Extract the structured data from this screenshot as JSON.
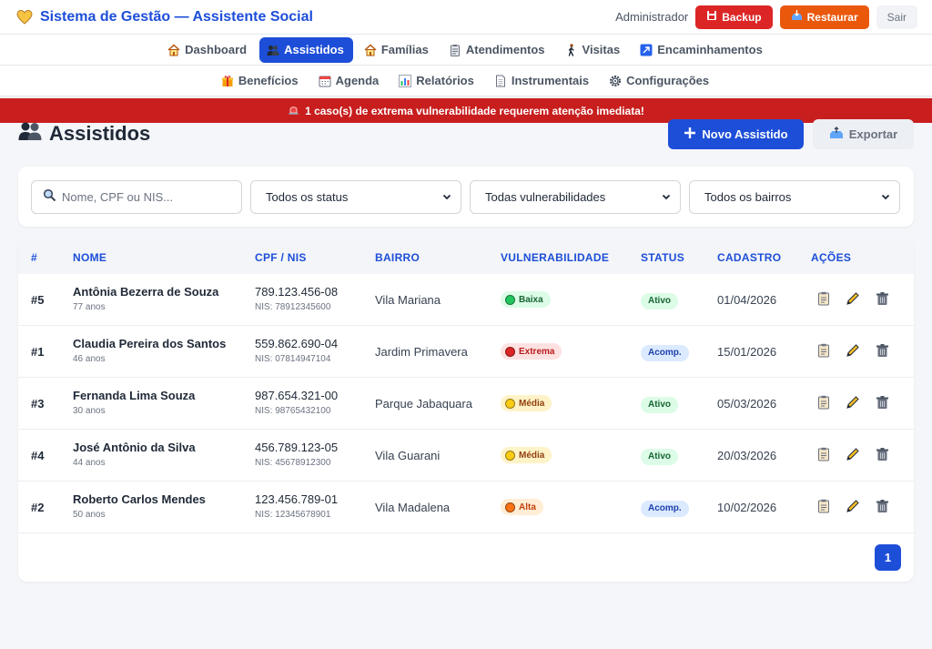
{
  "app": {
    "title": "Sistema de Gestão — Assistente Social",
    "user": "Administrador",
    "backup_label": "Backup",
    "restore_label": "Restaurar",
    "logout_label": "Sair"
  },
  "nav": {
    "primary": [
      {
        "label": "Dashboard",
        "icon": "house-icon",
        "active": false
      },
      {
        "label": "Assistidos",
        "icon": "people-icon",
        "active": true
      },
      {
        "label": "Famílias",
        "icon": "house-icon",
        "active": false
      },
      {
        "label": "Atendimentos",
        "icon": "clipboard-icon",
        "active": false
      },
      {
        "label": "Visitas",
        "icon": "walking-icon",
        "active": false
      },
      {
        "label": "Encaminhamentos",
        "icon": "arrow-up-right-icon",
        "active": false
      }
    ],
    "secondary": [
      {
        "label": "Benefícios",
        "icon": "gift-icon"
      },
      {
        "label": "Agenda",
        "icon": "calendar-icon"
      },
      {
        "label": "Relatórios",
        "icon": "bar-chart-icon"
      },
      {
        "label": "Instrumentais",
        "icon": "document-icon"
      },
      {
        "label": "Configurações",
        "icon": "gear-icon"
      }
    ]
  },
  "alert": {
    "text": "1 caso(s) de extrema vulnerabilidade requerem atenção imediata!",
    "icon": "siren-icon"
  },
  "page": {
    "title": "Assistidos",
    "new_label": "Novo Assistido",
    "export_label": "Exportar"
  },
  "filters": {
    "search_placeholder": "Nome, CPF ou NIS...",
    "status_value": "Todos os status",
    "vulnerability_value": "Todas vulnerabilidades",
    "neighborhood_value": "Todos os bairros"
  },
  "table": {
    "headers": [
      "#",
      "NOME",
      "CPF / NIS",
      "BAIRRO",
      "VULNERABILIDADE",
      "STATUS",
      "CADASTRO",
      "AÇÕES"
    ],
    "rows": [
      {
        "id": "#5",
        "name": "Antônia Bezerra de Souza",
        "age": "77 anos",
        "cpf": "789.123.456-08",
        "nis": "NIS: 78912345600",
        "bairro": "Vila Mariana",
        "vul": "Baixa",
        "vul_color": "#22c55e",
        "vul_bg": "#dcfce7",
        "vul_fg": "#166534",
        "status": "Ativo",
        "st_bg": "#dcfce7",
        "st_fg": "#166534",
        "date": "01/04/2026"
      },
      {
        "id": "#1",
        "name": "Claudia Pereira dos Santos",
        "age": "46 anos",
        "cpf": "559.862.690-04",
        "nis": "NIS: 07814947104",
        "bairro": "Jardim Primavera",
        "vul": "Extrema",
        "vul_color": "#dc2626",
        "vul_bg": "#fee2e2",
        "vul_fg": "#b91c1c",
        "status": "Acomp.",
        "st_bg": "#dbeafe",
        "st_fg": "#1e40af",
        "date": "15/01/2026"
      },
      {
        "id": "#3",
        "name": "Fernanda Lima Souza",
        "age": "30 anos",
        "cpf": "987.654.321-00",
        "nis": "NIS: 98765432100",
        "bairro": "Parque Jabaquara",
        "vul": "Média",
        "vul_color": "#facc15",
        "vul_bg": "#fef3c7",
        "vul_fg": "#92400e",
        "status": "Ativo",
        "st_bg": "#dcfce7",
        "st_fg": "#166534",
        "date": "05/03/2026"
      },
      {
        "id": "#4",
        "name": "José Antônio da Silva",
        "age": "44 anos",
        "cpf": "456.789.123-05",
        "nis": "NIS: 45678912300",
        "bairro": "Vila Guarani",
        "vul": "Média",
        "vul_color": "#facc15",
        "vul_bg": "#fef3c7",
        "vul_fg": "#92400e",
        "status": "Ativo",
        "st_bg": "#dcfce7",
        "st_fg": "#166534",
        "date": "20/03/2026"
      },
      {
        "id": "#2",
        "name": "Roberto Carlos Mendes",
        "age": "50 anos",
        "cpf": "123.456.789-01",
        "nis": "NIS: 12345678901",
        "bairro": "Vila Madalena",
        "vul": "Alta",
        "vul_color": "#f97316",
        "vul_bg": "#ffedd5",
        "vul_fg": "#c2410c",
        "status": "Acomp.",
        "st_bg": "#dbeafe",
        "st_fg": "#1e40af",
        "date": "10/02/2026"
      }
    ]
  },
  "pagination": {
    "current": "1"
  },
  "colors": {
    "primary": "#1d4ed8",
    "danger": "#dc2626",
    "warning": "#ea580c"
  }
}
